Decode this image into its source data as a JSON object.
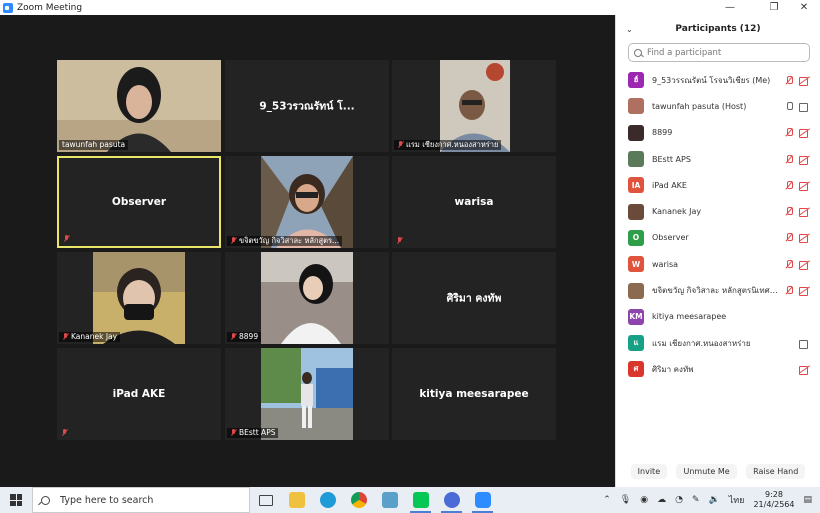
{
  "window": {
    "title": "Zoom Meeting"
  },
  "tiles": [
    {
      "name": "tawunfah pasuta",
      "big": "",
      "muted": false
    },
    {
      "name": "",
      "big": "9_53วรวณรัทน์ โ...",
      "muted": false
    },
    {
      "name": "แรม เชียงกาศ.หนองสาหร่าย",
      "big": "",
      "muted": true
    },
    {
      "name": "",
      "big": "Observer",
      "muted": true
    },
    {
      "name": "ขจิตขวัญ กิจวิสาละ หลักสูตร...",
      "big": "",
      "muted": true
    },
    {
      "name": "",
      "big": "warisa",
      "muted": true
    },
    {
      "name": "Kananek Jay",
      "big": "",
      "muted": true
    },
    {
      "name": "8899",
      "big": "",
      "muted": true
    },
    {
      "name": "",
      "big": "ศิริมา คงทัพ",
      "muted": false
    },
    {
      "name": "",
      "big": "iPad AKE",
      "muted": true
    },
    {
      "name": "BEstt APS",
      "big": "",
      "muted": true
    },
    {
      "name": "",
      "big": "kitiya meesarapee",
      "muted": false
    }
  ],
  "participants": {
    "title": "Participants (12)",
    "search_placeholder": "Find a participant",
    "items": [
      {
        "initials": "ฮ์",
        "name": "9_53วรรณรัตน์ โรจนวิเชียร (Me)",
        "color": "#9c27b0",
        "mic": "off",
        "cam": "off"
      },
      {
        "initials": "",
        "name": "tawunfah pasuta (Host)",
        "color": "#b07060",
        "mic": "on",
        "cam": "on"
      },
      {
        "initials": "",
        "name": "8899",
        "color": "#3a2a2a",
        "mic": "off",
        "cam": "off"
      },
      {
        "initials": "",
        "name": "BEstt APS",
        "color": "#5a7a5a",
        "mic": "off",
        "cam": "off"
      },
      {
        "initials": "IA",
        "name": "iPad AKE",
        "color": "#e0533d",
        "mic": "off",
        "cam": "off"
      },
      {
        "initials": "",
        "name": "Kananek Jay",
        "color": "#6a4a3a",
        "mic": "off",
        "cam": "off"
      },
      {
        "initials": "O",
        "name": "Observer",
        "color": "#2e9e48",
        "mic": "off",
        "cam": "off"
      },
      {
        "initials": "W",
        "name": "warisa",
        "color": "#e0533d",
        "mic": "off",
        "cam": "off"
      },
      {
        "initials": "",
        "name": "ขจิตขวัญ กิจวิสาละ หลักสูตรนิเทศศาสต...",
        "color": "#8a6a50",
        "mic": "off",
        "cam": "off"
      },
      {
        "initials": "KM",
        "name": "kitiya meesarapee",
        "color": "#8e44ad",
        "mic": "none",
        "cam": "none"
      },
      {
        "initials": "แ",
        "name": "แรม เชียงกาศ.หนองสาหร่าย",
        "color": "#16a085",
        "mic": "none",
        "cam": "on"
      },
      {
        "initials": "ศ",
        "name": "ศิริมา คงทัพ",
        "color": "#d9372b",
        "mic": "none",
        "cam": "off"
      }
    ],
    "buttons": {
      "invite": "Invite",
      "unmute_me": "Unmute Me",
      "raise_hand": "Raise Hand"
    }
  },
  "taskbar": {
    "search_placeholder": "Type here to search",
    "language": "ไทย",
    "time": "9:28",
    "date": "21/4/2564"
  }
}
